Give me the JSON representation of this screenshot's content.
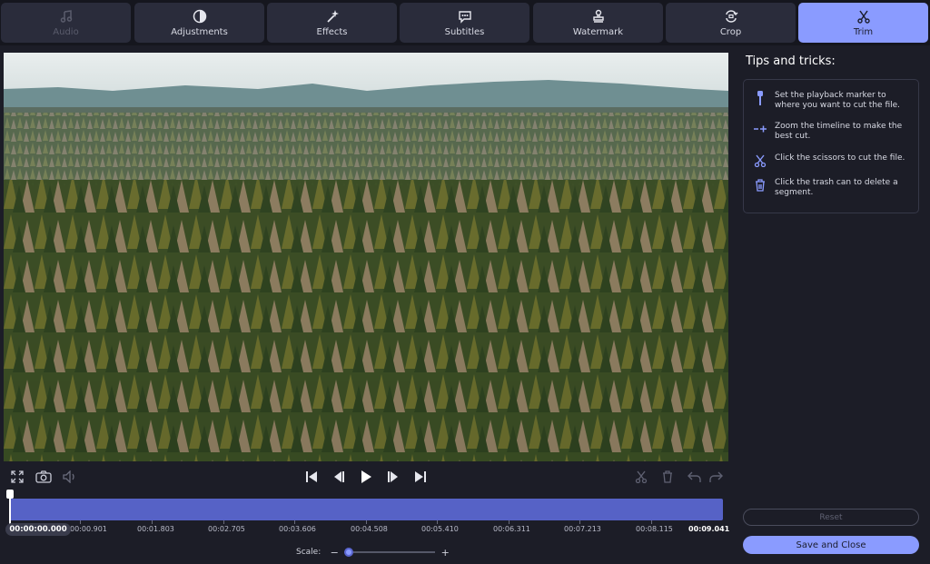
{
  "tabs": [
    {
      "label": "Audio",
      "icon": "music-note-icon",
      "state": "disabled"
    },
    {
      "label": "Adjustments",
      "icon": "contrast-icon",
      "state": "normal"
    },
    {
      "label": "Effects",
      "icon": "magic-wand-icon",
      "state": "normal"
    },
    {
      "label": "Subtitles",
      "icon": "speech-bubble-icon",
      "state": "normal"
    },
    {
      "label": "Watermark",
      "icon": "stamp-icon",
      "state": "normal"
    },
    {
      "label": "Crop",
      "icon": "crop-rotate-icon",
      "state": "normal"
    },
    {
      "label": "Trim",
      "icon": "scissors-icon",
      "state": "active"
    }
  ],
  "tips": {
    "title": "Tips and tricks:",
    "items": [
      {
        "icon": "playback-marker-icon",
        "text": "Set the playback marker to where you want to cut the file."
      },
      {
        "icon": "zoom-timeline-icon",
        "text": "Zoom the timeline to make the best cut."
      },
      {
        "icon": "scissors-icon",
        "text": "Click the scissors to cut the file."
      },
      {
        "icon": "trash-icon",
        "text": "Click the trash can to delete a segment."
      }
    ]
  },
  "controls": {
    "left": [
      "fullscreen-icon",
      "camera-icon",
      "volume-icon"
    ],
    "center": [
      "skip-to-start-icon",
      "previous-frame-icon",
      "play-icon",
      "next-frame-icon",
      "skip-to-end-icon"
    ],
    "right": [
      "scissors-icon",
      "trash-icon",
      "undo-icon",
      "redo-icon"
    ]
  },
  "timeline": {
    "current_time": "00:00:00.000",
    "end_time": "00:09.041",
    "ticks": [
      "00:00.901",
      "00:01.803",
      "00:02.705",
      "00:03.606",
      "00:04.508",
      "00:05.410",
      "00:06.311",
      "00:07.213",
      "00:08.115"
    ]
  },
  "scale": {
    "label": "Scale:",
    "minus": "−",
    "plus": "+",
    "value": 0.05
  },
  "buttons": {
    "reset": "Reset",
    "save": "Save and Close"
  },
  "colors": {
    "accent": "#8a9bff",
    "timeline": "#5662c6",
    "background": "#1c1d27"
  }
}
